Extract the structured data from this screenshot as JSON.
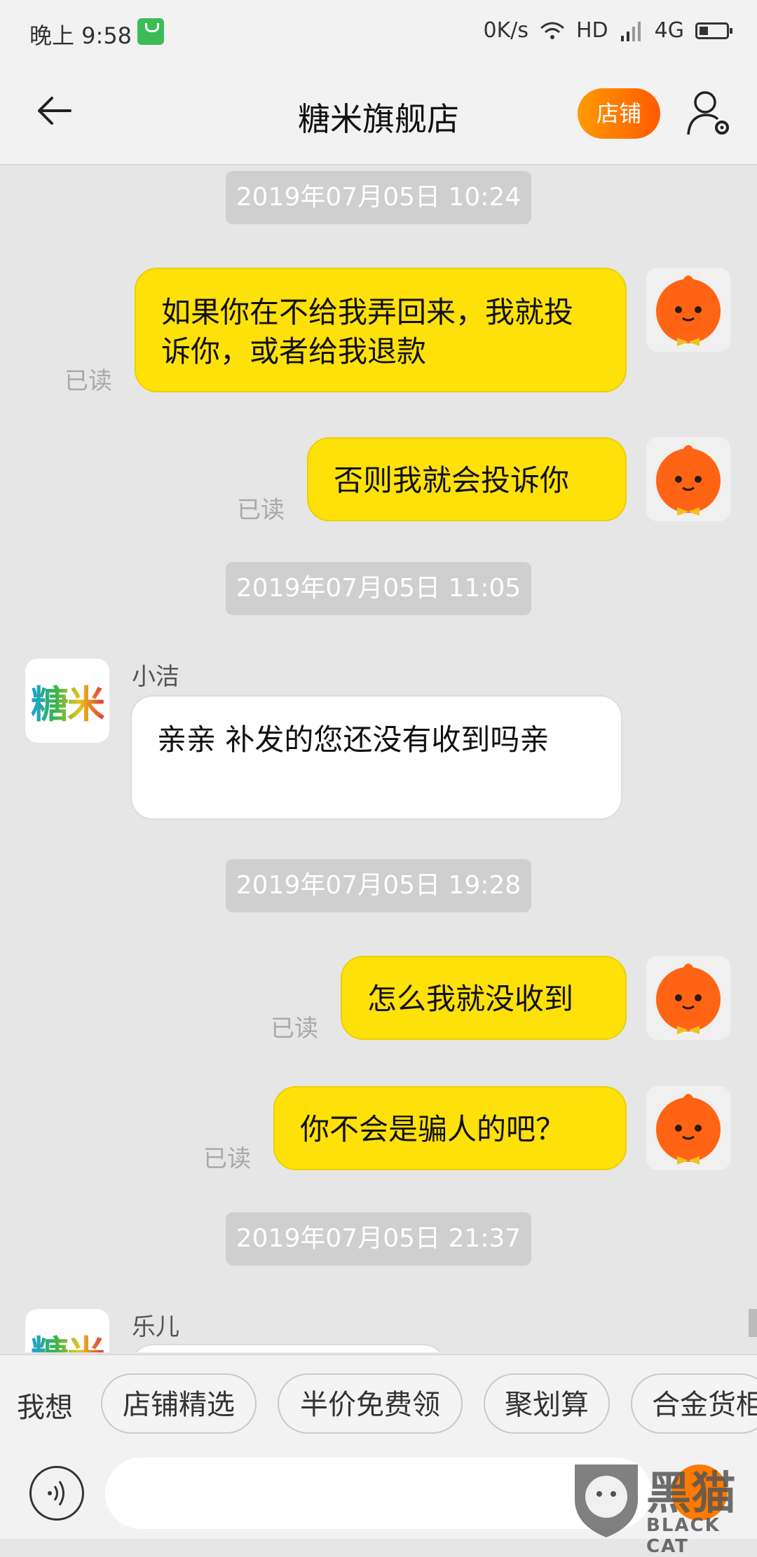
{
  "status_bar": {
    "time": "晚上 9:58",
    "speed": "0K/s",
    "hd": "HD",
    "network": "4G"
  },
  "header": {
    "title": "糖米旗舰店",
    "shop_button": "店铺"
  },
  "messages": [
    {
      "type": "timestamp",
      "text": "2019年07月05日 10:24"
    },
    {
      "type": "me",
      "text": "如果你在不给我弄回来，我就投诉你，或者给我退款",
      "read": "已读"
    },
    {
      "type": "me",
      "text": "否则我就会投诉你",
      "read": "已读"
    },
    {
      "type": "timestamp",
      "text": "2019年07月05日 11:05"
    },
    {
      "type": "other",
      "sender": "小洁",
      "text": "亲亲 补发的您还没有收到吗亲"
    },
    {
      "type": "timestamp",
      "text": "2019年07月05日 19:28"
    },
    {
      "type": "me",
      "text": "怎么我就没收到",
      "read": "已读"
    },
    {
      "type": "me",
      "text": "你不会是骗人的吧？",
      "read": "已读"
    },
    {
      "type": "timestamp",
      "text": "2019年07月05日 21:37"
    },
    {
      "type": "other",
      "sender": "乐儿",
      "text": ""
    }
  ],
  "shop_avatar_text": "糖米",
  "quick_bar": {
    "label": "我想",
    "chips": [
      "店铺精选",
      "半价免费领",
      "聚划算",
      "合金货柜"
    ]
  },
  "input": {
    "placeholder": ""
  },
  "watermark": {
    "main": "黑猫",
    "sub": "BLACK CAT"
  },
  "colors": {
    "my_bubble": "#ffe10a",
    "accent": "#ff7a00",
    "background": "#e6e6e6"
  }
}
